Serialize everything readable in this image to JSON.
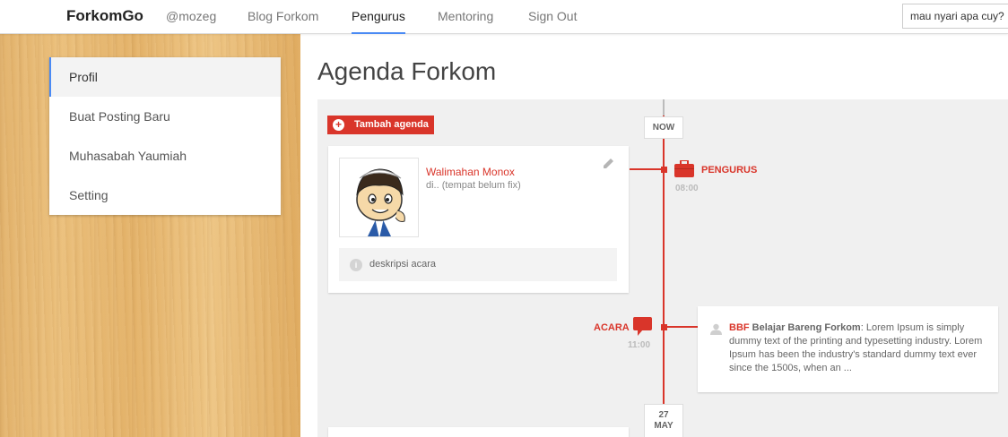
{
  "nav": {
    "brand": "ForkomGo",
    "user": "@mozeg",
    "links": [
      "Blog Forkom",
      "Pengurus",
      "Mentoring",
      "Sign Out"
    ],
    "active": "Pengurus",
    "search_value": "mau nyari apa cuy?"
  },
  "sidebar": {
    "items": [
      {
        "label": "Profil"
      },
      {
        "label": "Buat Posting Baru"
      },
      {
        "label": "Muhasabah Yaumiah"
      },
      {
        "label": "Setting"
      }
    ]
  },
  "main": {
    "title": "Agenda Forkom",
    "add_button": "Tambah agenda",
    "now_label": "NOW",
    "date_tag": {
      "day": "27",
      "month": "MAY"
    },
    "events": [
      {
        "label": "PENGURUS",
        "time": "08:00",
        "icon": "briefcase-icon",
        "card_title": "Walimahan Monox",
        "card_subtitle": "di.. (tempat belum fix)",
        "description": "deskripsi acara"
      },
      {
        "label": "ACARA",
        "time": "11:00",
        "icon": "speech-bubble-icon",
        "tag": "BBF",
        "post_title": "Belajar Bareng Forkom",
        "post_text": ": Lorem Ipsum is simply dummy text of the printing and typesetting industry. Lorem Ipsum has been the industry's standard dummy text ever since the 1500s, when an ..."
      }
    ]
  },
  "colors": {
    "accent_red": "#d9352a",
    "nav_active_underline": "#4a8af4",
    "wood": "#e6b870"
  }
}
